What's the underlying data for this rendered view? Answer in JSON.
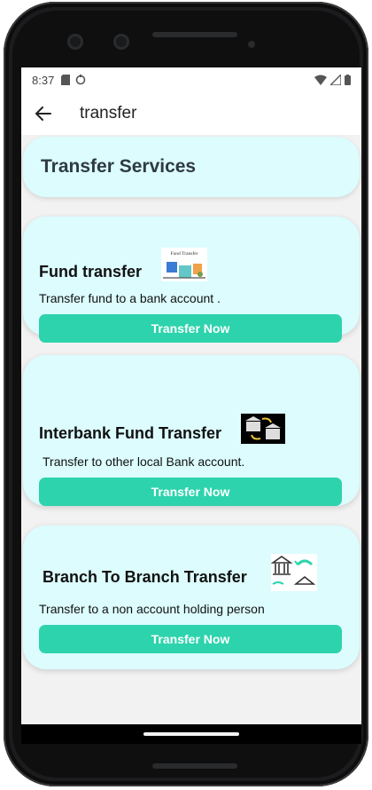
{
  "status_bar": {
    "time": "8:37"
  },
  "app_bar": {
    "title": "transfer"
  },
  "header": {
    "title": "Transfer Services"
  },
  "services": [
    {
      "title": "Fund transfer",
      "description": "Transfer fund to a bank account    .",
      "button": "Transfer Now",
      "image_caption": "Fund Transfer"
    },
    {
      "title": "Interbank Fund Transfer",
      "description": "Transfer to other local Bank account.",
      "button": "Transfer Now"
    },
    {
      "title": "Branch To Branch Transfer",
      "description": "Transfer to a non account holding person",
      "button": "Transfer Now"
    }
  ],
  "colors": {
    "accent": "#2dd3ac",
    "card": "#dcfcfe",
    "background": "#f2f2f2"
  }
}
